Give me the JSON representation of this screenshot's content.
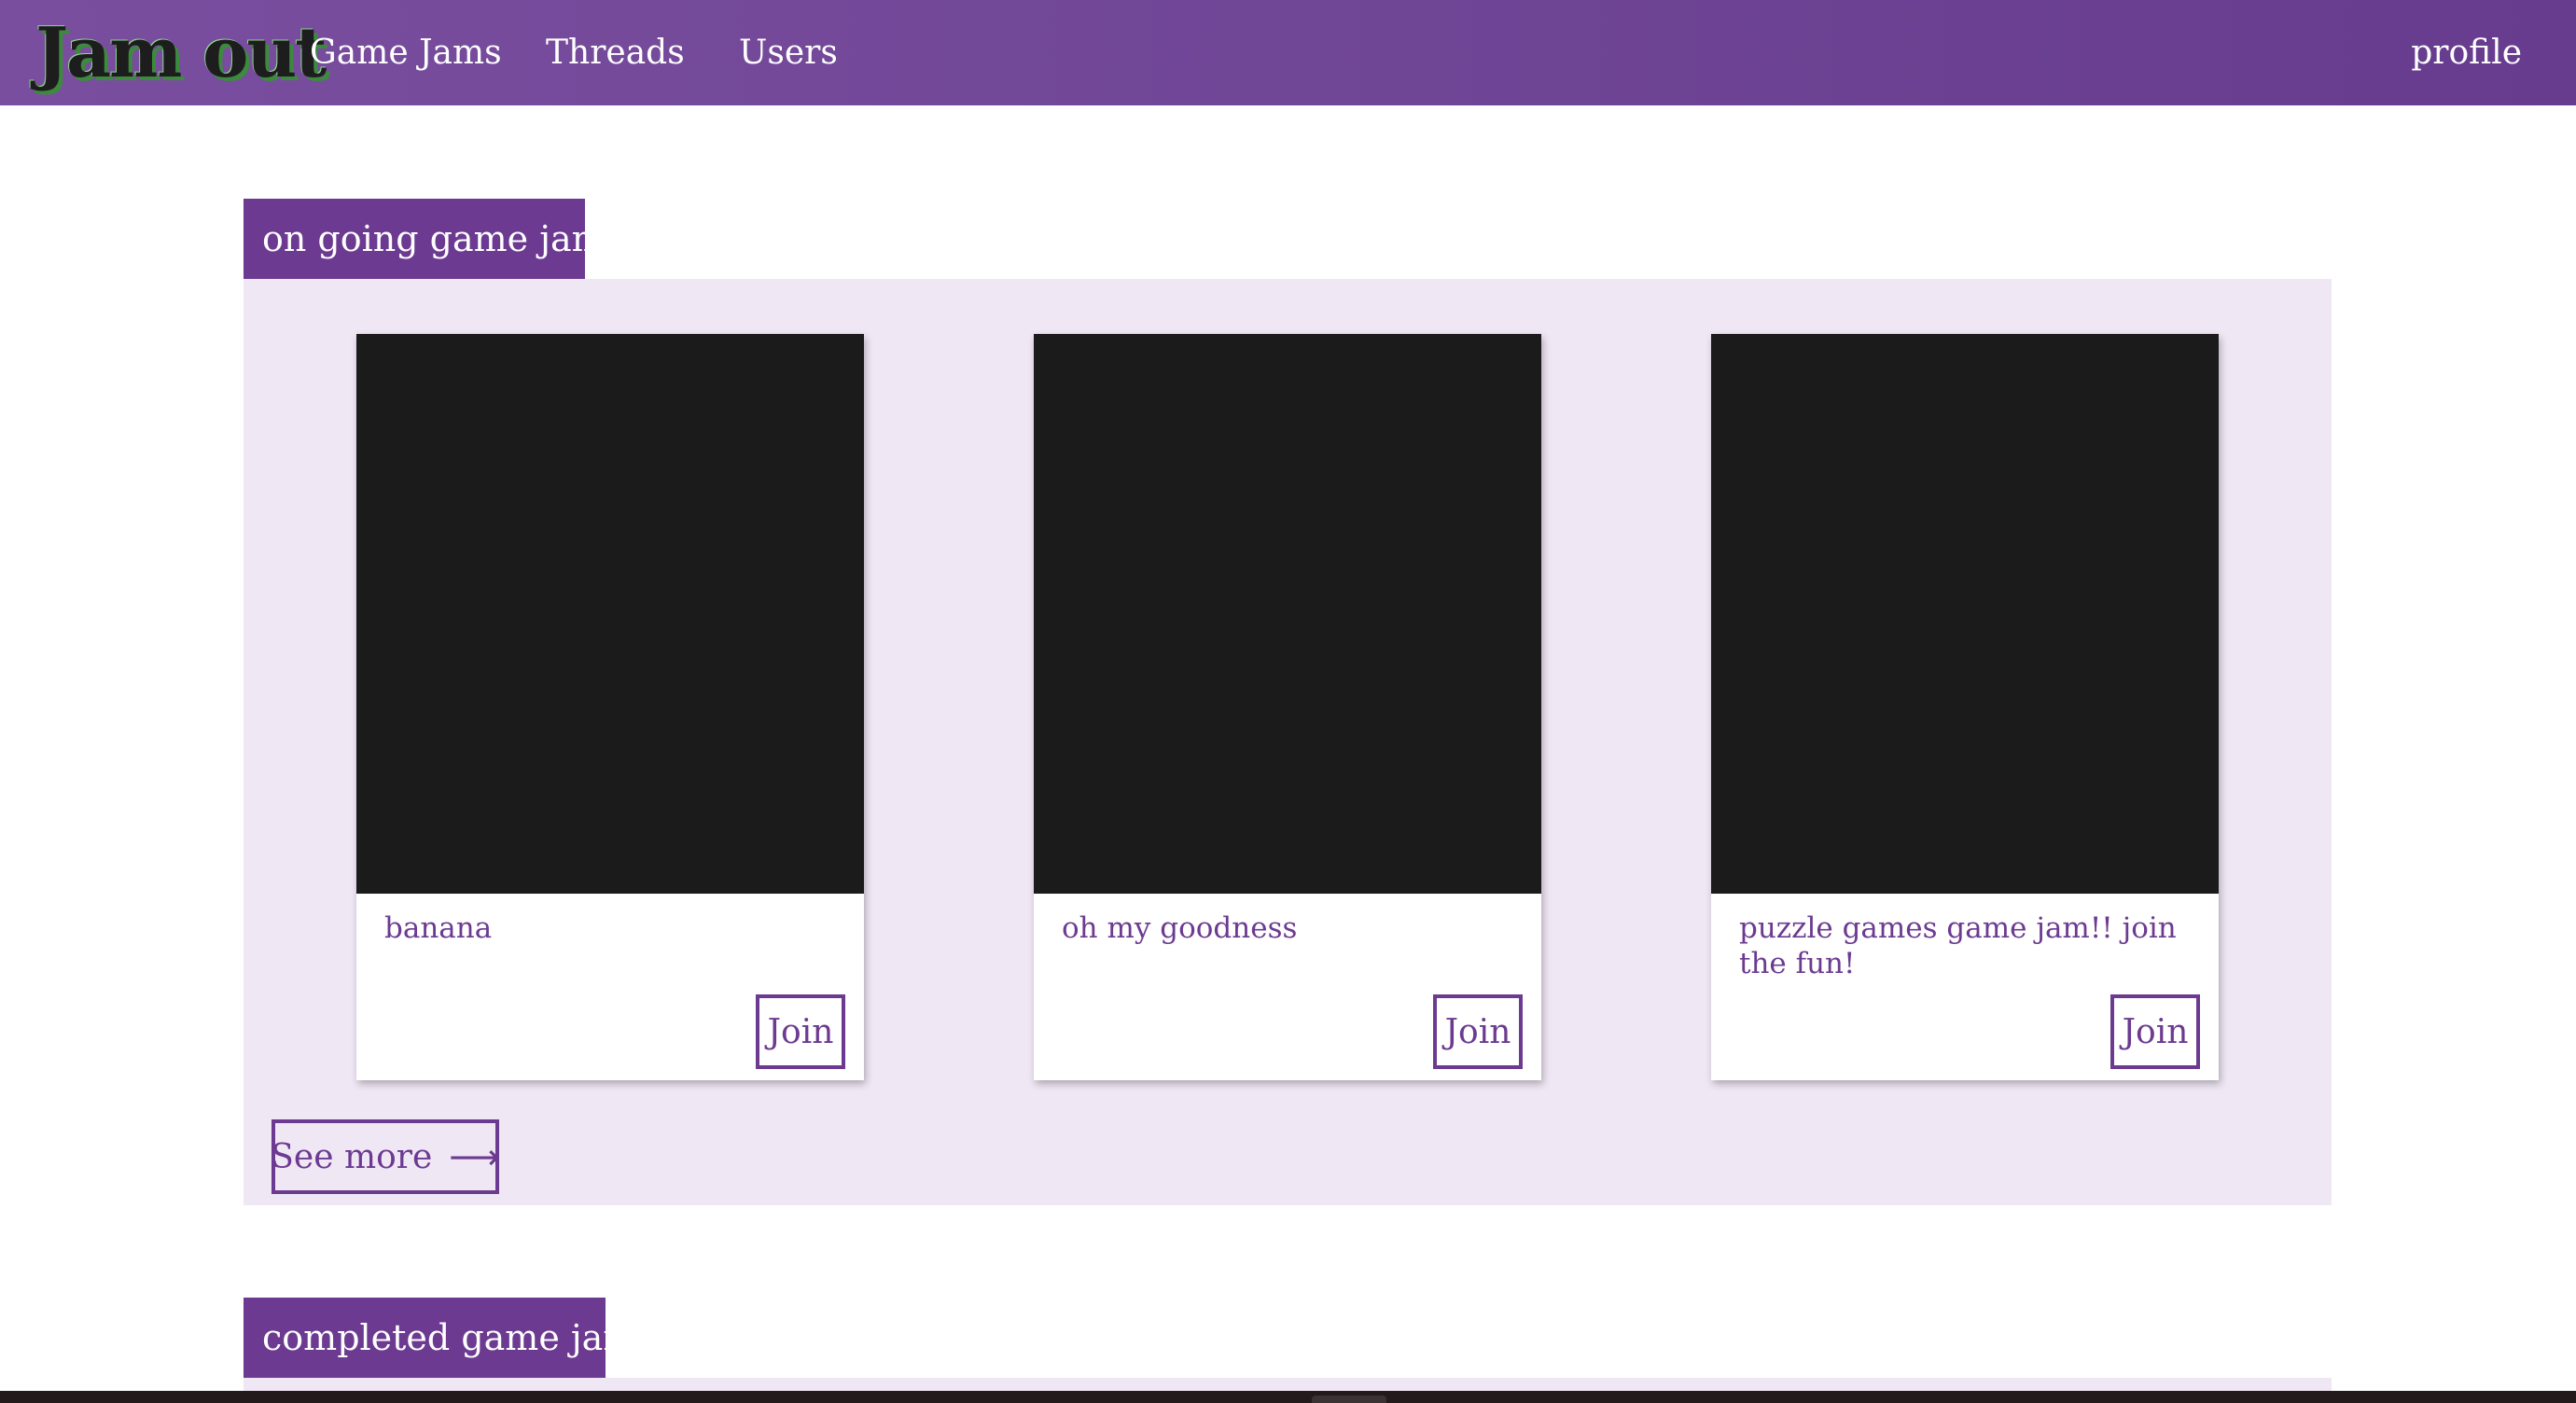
{
  "navbar": {
    "logo": "Jam out",
    "links": {
      "game_jams": "Game Jams",
      "threads": "Threads",
      "users": "Users",
      "profile": "profile"
    }
  },
  "ongoing": {
    "heading": "on going game jams",
    "cards": [
      {
        "title": "banana",
        "join_label": "Join"
      },
      {
        "title": "oh my goodness",
        "join_label": "Join"
      },
      {
        "title": "puzzle games game jam!! join the fun!",
        "join_label": "Join"
      }
    ],
    "see_more_label": "See more",
    "see_more_icon": "long-right-arrow-icon"
  },
  "completed": {
    "heading": "completed game jams"
  },
  "colors": {
    "brand_purple": "#6c3b91",
    "panel_background": "#f0e7f5",
    "card_image": "#1b1b1b",
    "logo_accent_green": "#3c8a3e"
  }
}
